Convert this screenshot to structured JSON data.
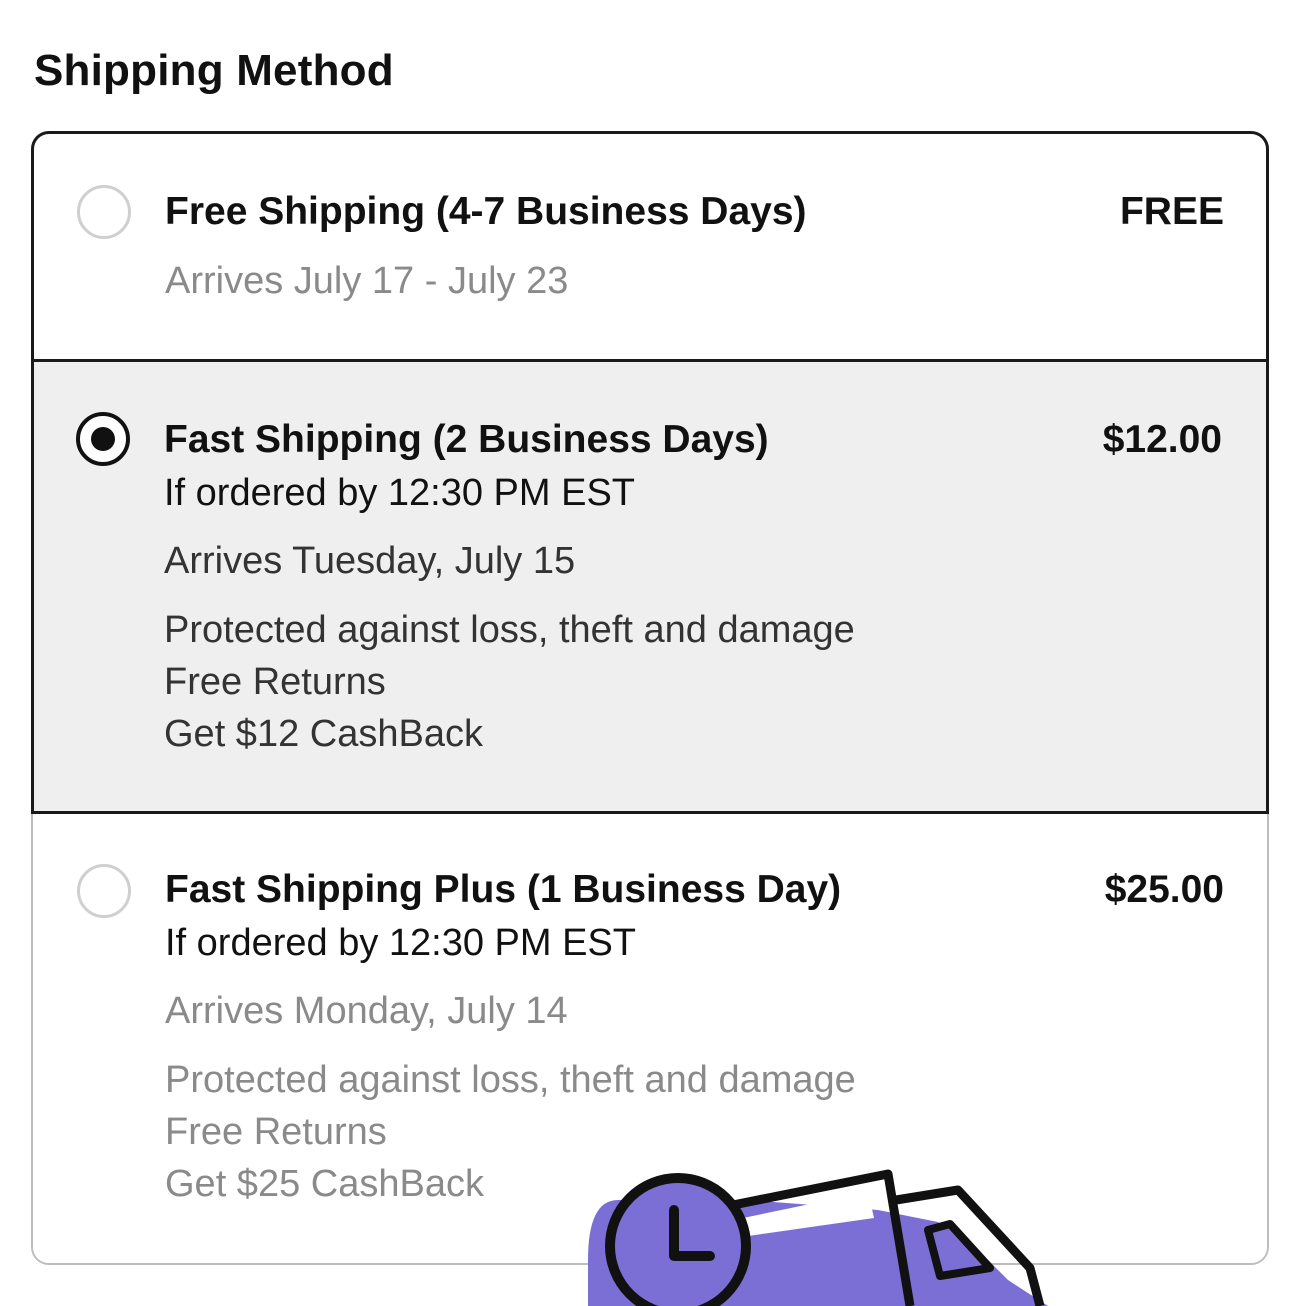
{
  "page": {
    "heading": "Shipping Method"
  },
  "options": [
    {
      "title": "Free Shipping (4-7 Business Days)",
      "price": "FREE",
      "arrives": "Arrives July 17 - July 23",
      "selected": false
    },
    {
      "title": "Fast Shipping (2 Business Days)",
      "price": "$12.00",
      "cutoff": "If ordered by 12:30 PM EST",
      "arrives": "Arrives Tuesday, July 15",
      "features": [
        "Protected against loss, theft and damage",
        "Free Returns",
        "Get $12 CashBack"
      ],
      "selected": true
    },
    {
      "title": "Fast Shipping Plus (1 Business Day)",
      "price": "$25.00",
      "cutoff": "If ordered by 12:30 PM EST",
      "arrives": "Arrives Monday, July 14",
      "features": [
        "Protected against loss, theft and damage",
        "Free Returns",
        "Get $25 CashBack"
      ],
      "selected": false
    }
  ],
  "colors": {
    "accent_purple": "#7b6fd6",
    "selected_background": "#efefef",
    "muted_text": "#8a8a8a",
    "border_dark": "#1a1a1a",
    "border_light": "#bdbdbd"
  },
  "icons": {
    "truck": "fast-delivery-truck-icon",
    "clock": "clock-icon"
  }
}
